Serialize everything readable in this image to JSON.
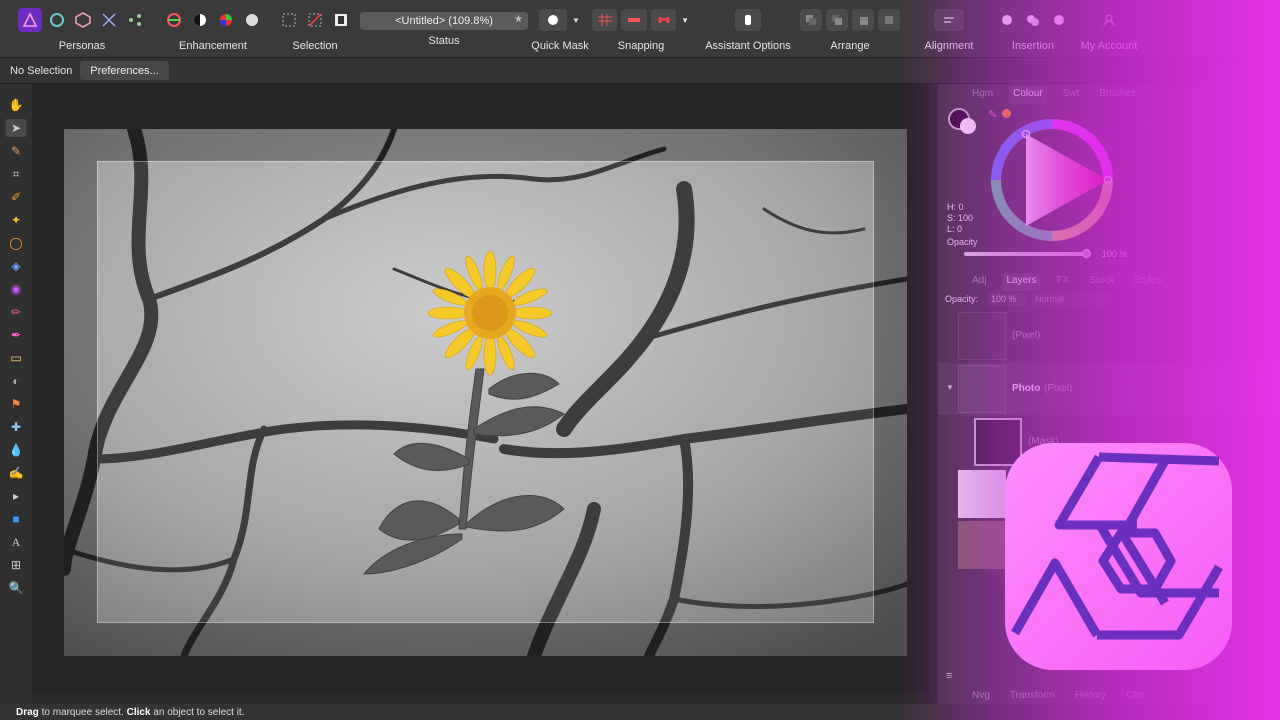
{
  "toolbar": {
    "personas_label": "Personas",
    "enhancement_label": "Enhancement",
    "selection_label": "Selection",
    "status_label": "Status",
    "status_value": "<Untitled> (109.8%)",
    "quickmask_label": "Quick Mask",
    "snapping_label": "Snapping",
    "assistant_label": "Assistant Options",
    "arrange_label": "Arrange",
    "alignment_label": "Alignment",
    "insertion_label": "Insertion",
    "account_label": "My Account"
  },
  "context": {
    "selection_label": "No Selection",
    "preferences_label": "Preferences..."
  },
  "colour_panel": {
    "tabs": [
      "Hgm",
      "Colour",
      "Swt",
      "Brushes"
    ],
    "active_tab": "Colour",
    "h_label": "H: 0",
    "s_label": "S: 100",
    "l_label": "L: 0",
    "opacity_label": "Opacity",
    "opacity_value": "100 %"
  },
  "layers_panel": {
    "tabs": [
      "Adj",
      "Layers",
      "FX",
      "Stock",
      "Styles"
    ],
    "active_tab": "Layers",
    "opacity_label": "Opacity:",
    "opacity_value": "100 %",
    "blend_mode": "Normal",
    "layers": [
      {
        "name": "",
        "type": "(Pixel)"
      },
      {
        "name": "Photo",
        "type": "(Pixel)"
      },
      {
        "name": "",
        "type": "(Mask)"
      }
    ]
  },
  "bottom_tabs": [
    "Nvg",
    "Transform",
    "History",
    "Chn"
  ],
  "statusbar": {
    "drag_word": "Drag",
    "drag_text": " to marquee select. ",
    "click_word": "Click",
    "click_text": " an object to select it."
  },
  "colors": {
    "accent_purple": "#e040ff",
    "logo_pink": "#ff6bff",
    "flower_yellow": "#f5c518"
  }
}
